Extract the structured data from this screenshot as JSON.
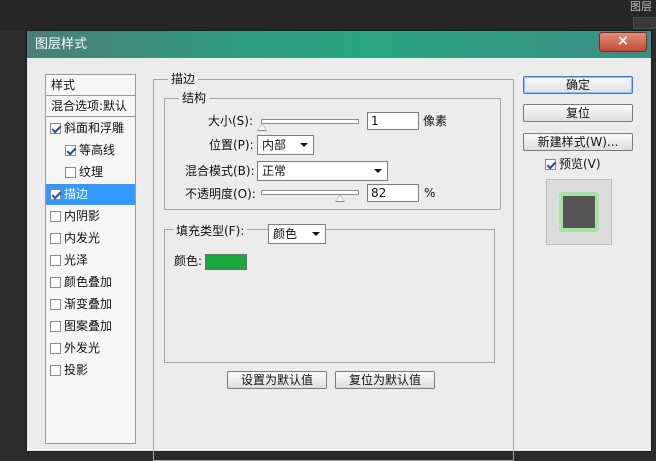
{
  "background": {
    "right_label": "图层"
  },
  "dialog": {
    "title": "图层样式",
    "close_symbol": "×",
    "colors": {
      "title_gradient": "#2aa57f",
      "selection": "#3399ff",
      "stroke_color": "#1aa83c"
    }
  },
  "style_list": {
    "header": "样式",
    "blend_header": "混合选项:默认",
    "items": [
      {
        "label": "斜面和浮雕",
        "checked": true
      },
      {
        "label": "等高线",
        "checked": true
      },
      {
        "label": "纹理",
        "checked": false
      },
      {
        "label": "描边",
        "checked": true,
        "selected": true
      },
      {
        "label": "内阴影",
        "checked": false
      },
      {
        "label": "内发光",
        "checked": false
      },
      {
        "label": "光泽",
        "checked": false
      },
      {
        "label": "颜色叠加",
        "checked": false
      },
      {
        "label": "渐变叠加",
        "checked": false
      },
      {
        "label": "图案叠加",
        "checked": false
      },
      {
        "label": "外发光",
        "checked": false
      },
      {
        "label": "投影",
        "checked": false
      }
    ]
  },
  "stroke_panel": {
    "title": "描边",
    "structure": {
      "title": "结构",
      "size_label": "大小(S):",
      "size_value": "1",
      "size_unit": "像素",
      "position_label": "位置(P):",
      "position_value": "内部",
      "blend_label": "混合模式(B):",
      "blend_value": "正常",
      "opacity_label": "不透明度(O):",
      "opacity_value": "82",
      "opacity_unit": "%",
      "size_slider_level": 0.01,
      "opacity_slider_level": 0.82
    },
    "fill": {
      "type_label": "填充类型(F):",
      "type_value": "颜色",
      "color_label": "颜色:"
    },
    "set_default_label": "设置为默认值",
    "reset_default_label": "复位为默认值"
  },
  "actions": {
    "ok_label": "确定",
    "reset_label": "复位",
    "new_style_label": "新建样式(W)...",
    "preview_label": "预览(V)",
    "preview_checked": true
  }
}
